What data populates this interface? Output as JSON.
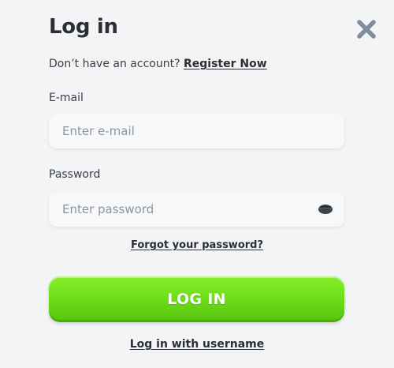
{
  "modal": {
    "title": "Log in",
    "close_icon": "close-icon"
  },
  "register": {
    "prompt": "Don’t have an account? ",
    "link": "Register Now"
  },
  "email": {
    "label": "E-mail",
    "placeholder": "Enter e-mail",
    "value": ""
  },
  "password": {
    "label": "Password",
    "placeholder": "Enter password",
    "value": "",
    "toggle_icon": "eye-icon"
  },
  "forgot": {
    "link": "Forgot your password?"
  },
  "login_button": {
    "label": "LOG IN"
  },
  "alt_login": {
    "link": "Log in with username"
  },
  "colors": {
    "background": "#f3f4f6",
    "text": "#2b2f33",
    "button_green": "#6ee01a",
    "close_icon": "#7f8c99"
  }
}
